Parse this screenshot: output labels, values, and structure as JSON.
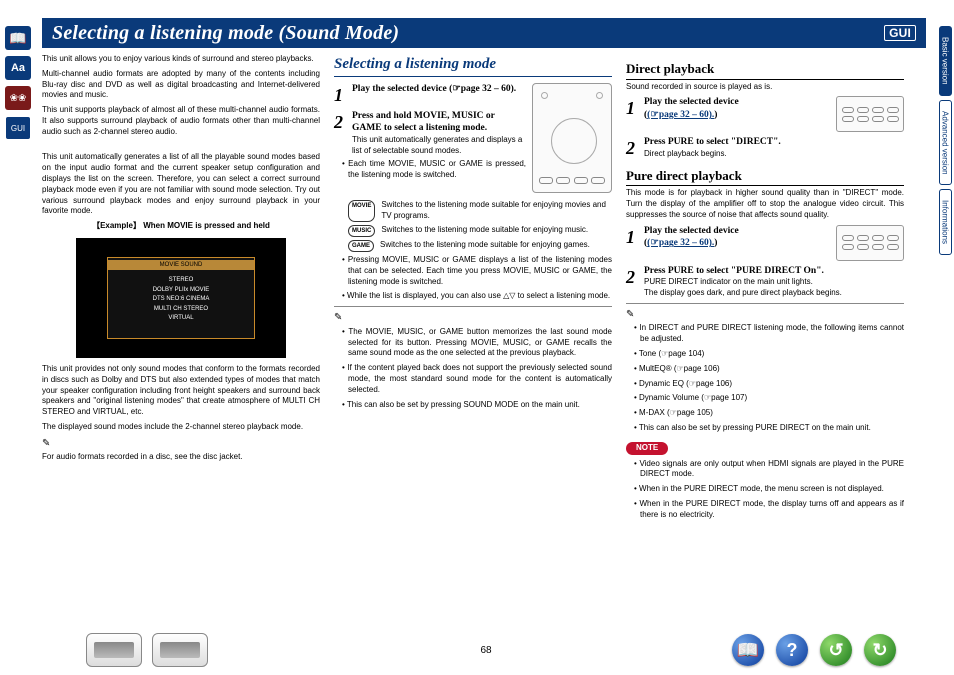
{
  "page_number": "68",
  "title": "Selecting a listening mode (Sound Mode)",
  "gui_badge": "GUI",
  "left_rail": {
    "aa": "Aa",
    "sym": "❀❀",
    "gui": "GUI"
  },
  "right_tabs": {
    "basic": "Basic version",
    "advanced": "Advanced version",
    "info": "Informations"
  },
  "col1": {
    "p1": "This unit allows you to enjoy various kinds of surround and stereo playbacks.",
    "p2": "Multi-channel audio formats are adopted by many of the contents including Blu-ray disc and DVD as well as digital broadcasting and Internet-delivered movies and music.",
    "p3": "This unit supports playback of almost all of these multi-channel audio formats. It also supports surround playback of audio formats other than multi-channel audio such as 2-channel stereo audio.",
    "p4": "This unit automatically generates a list of all the playable sound modes based on the input audio format and the current speaker setup configuration and displays the list on the screen. Therefore, you can select a correct surround playback mode even if you are not familiar with sound mode selection. Try out various surround playback modes and enjoy surround playback in your favorite mode.",
    "example_label": "【Example】 When MOVIE is pressed and held",
    "example_header": "MOVIE SOUND",
    "example_items": [
      "STEREO",
      "DOLBY PLIIx MOVIE",
      "DTS NEO:6 CINEMA",
      "MULTI CH STEREO",
      "VIRTUAL"
    ],
    "p5": "This unit provides not only sound modes that conform to the formats recorded in discs such as Dolby and DTS but also extended types of modes that match your speaker configuration including front height speakers and surround back speakers and \"original listening modes\" that create atmosphere of MULTI CH STEREO and VIRTUAL, etc.",
    "p6": "The displayed sound modes include the 2-channel stereo playback mode.",
    "p7": "For audio formats recorded in a disc, see the disc jacket."
  },
  "col2": {
    "subhead": "Selecting a listening mode",
    "step1": "Play the selected device (☞page 32 – 60).",
    "step2a": "Press and hold MOVIE, MUSIC or GAME to select a listening mode.",
    "step2b": "This unit automatically generates and displays a list of selectable sound modes.",
    "b1": "Each time MOVIE, MUSIC or GAME is pressed, the listening mode is switched.",
    "mode_movie": "MOVIE",
    "mode_music": "MUSIC",
    "mode_game": "GAME",
    "mv": "Switches to the listening mode suitable for enjoying movies and TV programs.",
    "mu": "Switches to the listening mode suitable for enjoying music.",
    "gm": "Switches to the listening mode suitable for enjoying games.",
    "b2": "Pressing MOVIE, MUSIC or GAME displays a list of the listening modes that can be selected. Each time you press MOVIE, MUSIC or GAME, the listening mode is switched.",
    "b3": "While the list is displayed, you can also use △▽ to select a listening mode.",
    "n1": "The MOVIE, MUSIC, or GAME button memorizes the last sound mode selected for its button. Pressing MOVIE, MUSIC, or GAME recalls the same sound mode as the one selected at the previous playback.",
    "n2": "If the content played back does not support the previously selected sound mode, the most standard sound mode for the content is automatically selected.",
    "n3": "This can also be set by pressing SOUND MODE on the main unit."
  },
  "col3": {
    "h_direct": "Direct playback",
    "dp_intro": "Sound recorded in source is played as is.",
    "dp_s1": "Play the selected device",
    "dp_s1b": "(☞page 32 – 60).",
    "dp_s2": "Press PURE to select \"DIRECT\".",
    "dp_s2b": "Direct playback begins.",
    "h_pure": "Pure direct playback",
    "pd_intro": "This mode is for playback in higher sound quality than in \"DIRECT\" mode. Turn the display of the amplifier off to stop the analogue video circuit. This suppresses the source of noise that affects sound quality.",
    "pd_s1": "Play the selected device",
    "pd_s1b": "(☞page 32 – 60).",
    "pd_s2": "Press PURE to select \"PURE DIRECT On\".",
    "pd_s2b": "PURE DIRECT indicator on the main unit lights.",
    "pd_s2c": "The display goes dark, and pure direct playback begins.",
    "nl_intro": "In DIRECT and PURE DIRECT listening mode, the following items cannot be adjusted.",
    "nl1": "Tone (☞page 104)",
    "nl2": "MultEQ® (☞page 106)",
    "nl3": "Dynamic EQ (☞page 106)",
    "nl4": "Dynamic Volume (☞page 107)",
    "nl5": "M-DAX (☞page 105)",
    "nl_also": "This can also be set by pressing PURE DIRECT on the main unit.",
    "note": "NOTE",
    "note1": "Video signals are only output when HDMI signals are played in the PURE DIRECT mode.",
    "note2": "When in the PURE DIRECT mode, the menu screen is not displayed.",
    "note3": "When in the PURE DIRECT mode, the display turns off and appears as if there is no electricity."
  }
}
